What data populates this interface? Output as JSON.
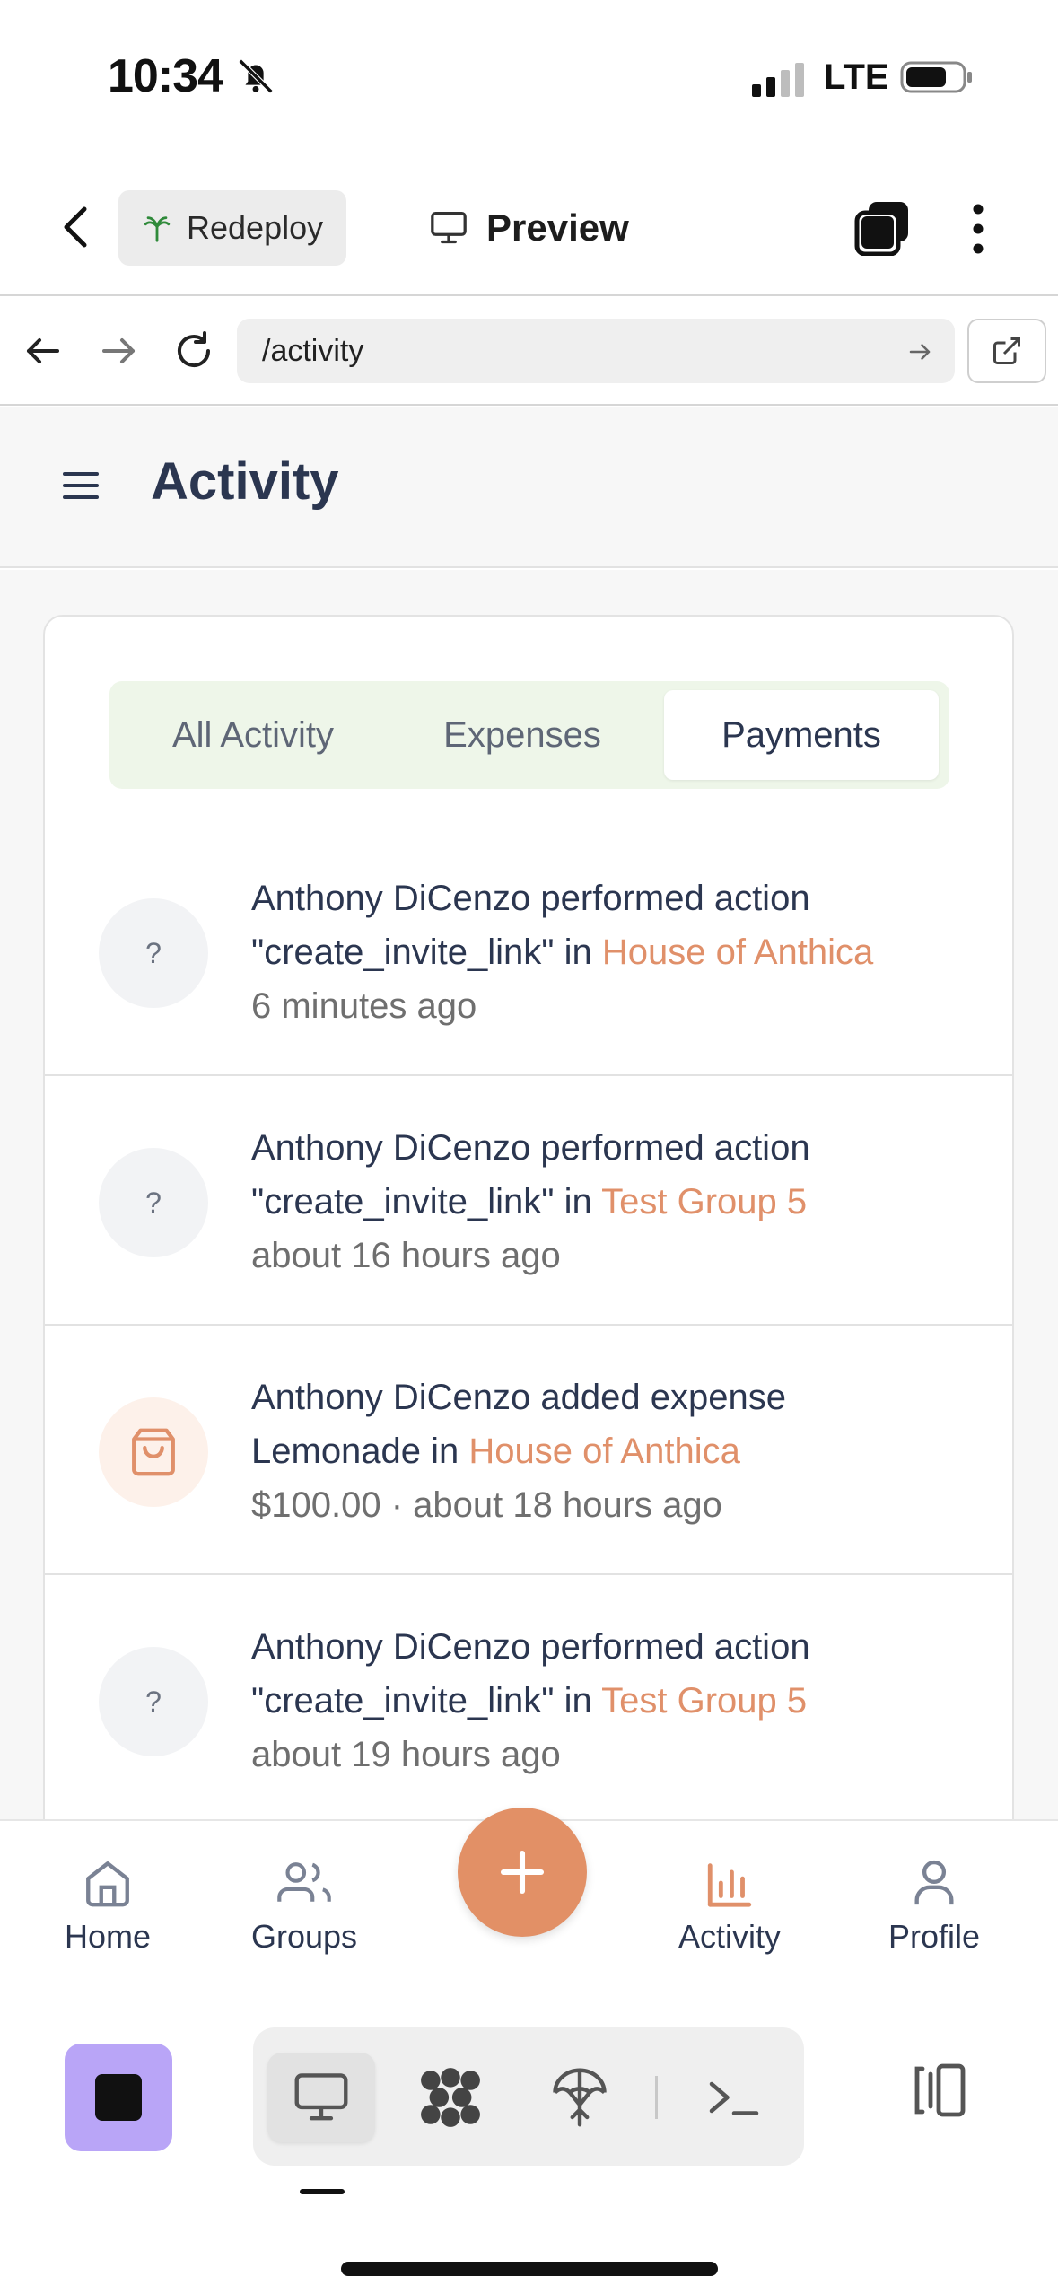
{
  "status_bar": {
    "time": "10:34",
    "network": "LTE"
  },
  "app_bar": {
    "redeploy_label": "Redeploy",
    "preview_label": "Preview"
  },
  "url_bar": {
    "path": "/activity"
  },
  "page": {
    "title": "Activity"
  },
  "tabs": [
    {
      "label": "All Activity",
      "active": false
    },
    {
      "label": "Expenses",
      "active": false
    },
    {
      "label": "Payments",
      "active": true
    }
  ],
  "activity_items": [
    {
      "avatar": "?",
      "line1": "Anthony DiCenzo performed action",
      "line2_prefix": "\"create_invite_link\" in ",
      "group": "House of Anthica",
      "meta": "6 minutes ago",
      "type": "action"
    },
    {
      "avatar": "?",
      "line1": "Anthony DiCenzo performed action",
      "line2_prefix": "\"create_invite_link\" in ",
      "group": "Test Group 5",
      "meta": "about 16 hours ago",
      "type": "action"
    },
    {
      "avatar": "shopping-bag-icon",
      "line1": "Anthony DiCenzo added expense",
      "line2_prefix": "Lemonade in ",
      "group": "House of Anthica",
      "meta": "$100.00 · about 18 hours ago",
      "type": "expense"
    },
    {
      "avatar": "?",
      "line1": "Anthony DiCenzo performed action",
      "line2_prefix": "\"create_invite_link\" in ",
      "group": "Test Group 5",
      "meta": "about 19 hours ago",
      "type": "action"
    }
  ],
  "bottom_nav": {
    "home": "Home",
    "groups": "Groups",
    "activity": "Activity",
    "profile": "Profile",
    "active": "activity"
  },
  "colors": {
    "accent": "#e29066",
    "title": "#2b3650",
    "tab_bg": "#eef6e9",
    "dev_square": "#b9a5f7"
  }
}
